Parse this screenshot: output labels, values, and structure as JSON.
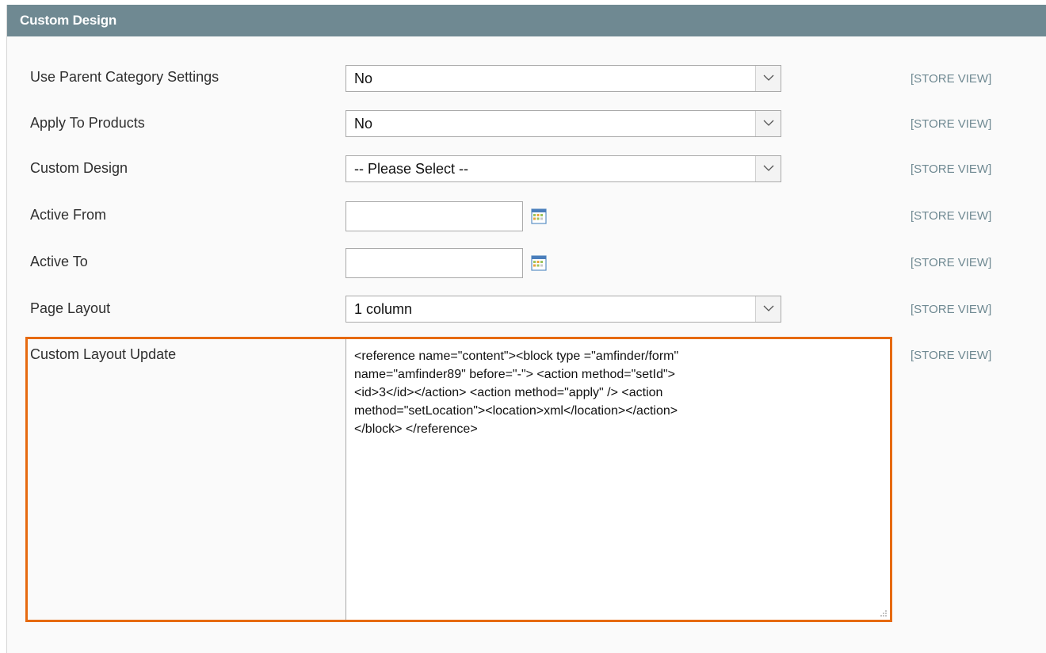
{
  "section": {
    "title": "Custom Design"
  },
  "scope_label": "[STORE VIEW]",
  "fields": {
    "use_parent": {
      "label": "Use Parent Category Settings",
      "value": "No"
    },
    "apply_products": {
      "label": "Apply To Products",
      "value": "No"
    },
    "custom_design": {
      "label": "Custom Design",
      "value": "-- Please Select --"
    },
    "active_from": {
      "label": "Active From",
      "value": ""
    },
    "active_to": {
      "label": "Active To",
      "value": ""
    },
    "page_layout": {
      "label": "Page Layout",
      "value": "1 column"
    },
    "layout_update": {
      "label": "Custom Layout Update",
      "value": "<reference name=\"content\"><block type =\"amfinder/form\"\nname=\"amfinder89\" before=\"-\"> <action method=\"setId\">\n<id>3</id></action> <action method=\"apply\" /> <action\nmethod=\"setLocation\"><location>xml</location></action>\n</block> </reference>"
    }
  },
  "icons": {
    "dropdown": "chevron-down-icon",
    "calendar": "calendar-icon",
    "resize": "resize-grip-icon"
  },
  "colors": {
    "header": "#6f8992",
    "highlight": "#e66a10",
    "scope": "#6f8992"
  }
}
